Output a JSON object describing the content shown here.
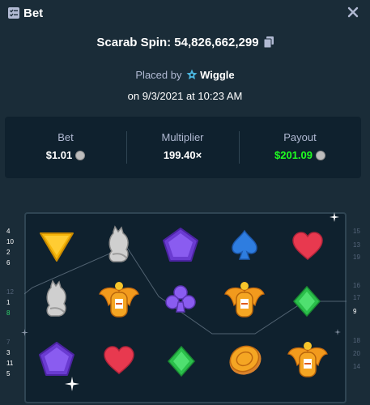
{
  "header": {
    "title": "Bet",
    "icon": "bet-list-icon",
    "close_icon": "close-icon"
  },
  "game": {
    "title": "Scarab Spin: 54,826,662,299",
    "copy_icon": "copy-icon"
  },
  "placed": {
    "prefix": "Placed by",
    "user": "Wiggle",
    "user_icon": "star-badge-icon",
    "date": "on 9/3/2021 at 10:23 AM"
  },
  "stats": {
    "bet": {
      "label": "Bet",
      "value": "$1.01"
    },
    "multiplier": {
      "label": "Multiplier",
      "value": "199.40×"
    },
    "payout": {
      "label": "Payout",
      "value": "$201.09"
    },
    "currency_icon": "litecoin-icon",
    "payout_color": "#1fff20"
  },
  "board": {
    "reels": [
      [
        "yellow-triangle",
        "silver-cat",
        "purple-pentagon"
      ],
      [
        "silver-cat",
        "golden-scarab",
        "red-heart"
      ],
      [
        "purple-pentagon",
        "purple-club",
        "green-diamond"
      ],
      [
        "blue-spade",
        "golden-scarab",
        "gold-coin"
      ],
      [
        "red-heart",
        "green-diamond",
        "golden-scarab"
      ]
    ],
    "left_numbers": [
      "4",
      "10",
      "2",
      "6",
      "12",
      "1",
      "8",
      "7",
      "3",
      "11",
      "5"
    ],
    "right_numbers": [
      "15",
      "13",
      "19",
      "16",
      "17",
      "9",
      "18",
      "20",
      "14"
    ],
    "highlighted_line": "8"
  }
}
